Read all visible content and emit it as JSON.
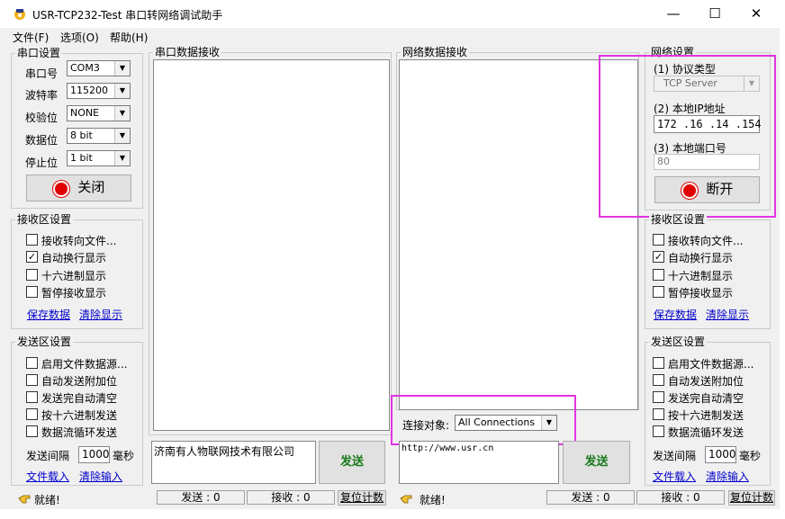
{
  "window": {
    "title": "USR-TCP232-Test 串口转网络调试助手",
    "minimize": "—",
    "maximize": "☐",
    "close": "✕"
  },
  "menu": [
    "文件(F)",
    "选项(O)",
    "帮助(H)"
  ],
  "serial": {
    "title": "串口设置",
    "port_label": "串口号",
    "port": "COM3",
    "baud_label": "波特率",
    "baud": "115200",
    "parity_label": "校验位",
    "parity": "NONE",
    "data_label": "数据位",
    "data": "8 bit",
    "stop_label": "停止位",
    "stop": "1 bit",
    "close_button": "关闭"
  },
  "left_recv": {
    "title": "接收区设置",
    "options": [
      {
        "label": "接收转向文件...",
        "checked": false
      },
      {
        "label": "自动换行显示",
        "checked": true
      },
      {
        "label": "十六进制显示",
        "checked": false
      },
      {
        "label": "暂停接收显示",
        "checked": false
      }
    ],
    "save_link": "保存数据",
    "clear_link": "清除显示"
  },
  "left_send": {
    "title": "发送区设置",
    "options": [
      {
        "label": "启用文件数据源...",
        "checked": false
      },
      {
        "label": "自动发送附加位",
        "checked": false
      },
      {
        "label": "发送完自动清空",
        "checked": false
      },
      {
        "label": "按十六进制发送",
        "checked": false
      },
      {
        "label": "数据流循环发送",
        "checked": false
      }
    ],
    "interval_label": "发送间隔",
    "interval_value": "1000",
    "interval_unit": "毫秒",
    "load_link": "文件载入",
    "clear_link": "清除输入"
  },
  "serial_recv": {
    "title": "串口数据接收"
  },
  "serial_send": {
    "text": "济南有人物联网技术有限公司",
    "send_button": "发送"
  },
  "net_recv": {
    "title": "网络数据接收"
  },
  "net_conn": {
    "label": "连接对象:",
    "value": "All Connections"
  },
  "net_send": {
    "text": "http://www.usr.cn",
    "send_button": "发送"
  },
  "net": {
    "title": "网络设置",
    "protocol_label": "(1) 协议类型",
    "protocol": "TCP Server",
    "ip_label": "(2) 本地IP地址",
    "ip": [
      "172",
      "16",
      "14",
      "154"
    ],
    "port_label": "(3) 本地端口号",
    "port": "80",
    "disconnect_button": "断开"
  },
  "right_recv": {
    "title": "接收区设置",
    "options": [
      {
        "label": "接收转向文件...",
        "checked": false
      },
      {
        "label": "自动换行显示",
        "checked": true
      },
      {
        "label": "十六进制显示",
        "checked": false
      },
      {
        "label": "暂停接收显示",
        "checked": false
      }
    ],
    "save_link": "保存数据",
    "clear_link": "清除显示"
  },
  "right_send": {
    "title": "发送区设置",
    "options": [
      {
        "label": "启用文件数据源...",
        "checked": false
      },
      {
        "label": "自动发送附加位",
        "checked": false
      },
      {
        "label": "发送完自动清空",
        "checked": false
      },
      {
        "label": "按十六进制发送",
        "checked": false
      },
      {
        "label": "数据流循环发送",
        "checked": false
      }
    ],
    "interval_label": "发送间隔",
    "interval_value": "1000",
    "interval_unit": "毫秒",
    "load_link": "文件载入",
    "clear_link": "清除输入"
  },
  "status_left": {
    "ready": "就绪!",
    "send": "发送 : 0",
    "recv": "接收 : 0",
    "reset": "复位计数"
  },
  "status_right": {
    "ready": "就绪!",
    "send": "发送 : 0",
    "recv": "接收 : 0",
    "reset": "复位计数"
  },
  "colors": {
    "highlight": "#e234e2",
    "led": "#e00000",
    "send_text": "#1a7a1a",
    "link": "#0000cc"
  }
}
